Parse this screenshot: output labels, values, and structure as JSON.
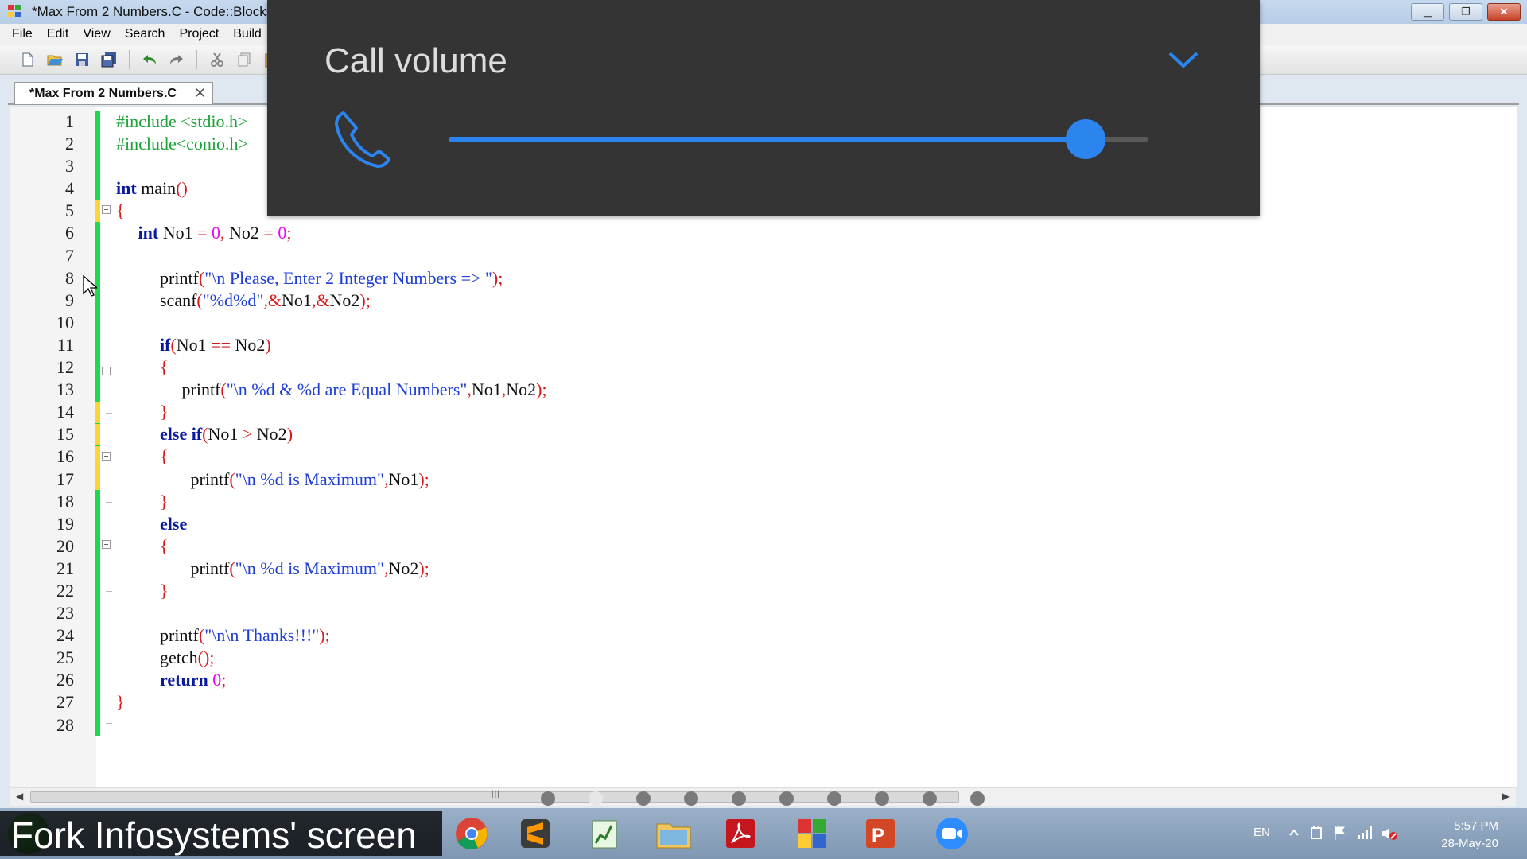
{
  "window": {
    "title": "*Max From 2 Numbers.C - Code::Blocks"
  },
  "menu": [
    "File",
    "Edit",
    "View",
    "Search",
    "Project",
    "Build"
  ],
  "toolbar_icons": [
    "new-file-icon",
    "open-icon",
    "save-icon",
    "save-all-icon",
    "undo-icon",
    "redo-icon",
    "cut-icon",
    "copy-icon",
    "paste-icon"
  ],
  "editor": {
    "tab_label": "*Max From 2 Numbers.C",
    "tab_close": "✕",
    "line_numbers": [
      "1",
      "2",
      "3",
      "4",
      "5",
      "6",
      "7",
      "8",
      "9",
      "10",
      "11",
      "12",
      "13",
      "14",
      "15",
      "16",
      "17",
      "18",
      "19",
      "20",
      "21",
      "22",
      "23",
      "24",
      "25",
      "26",
      "27",
      "28"
    ],
    "lines": [
      [
        {
          "t": "#include <stdio.h>",
          "c": "pp"
        }
      ],
      [
        {
          "t": "#include<conio.h>",
          "c": "pp"
        }
      ],
      [],
      [
        {
          "t": "int",
          "c": "kw"
        },
        {
          "t": " main",
          "c": "id"
        },
        {
          "t": "()",
          "c": "op"
        }
      ],
      [
        {
          "t": "{",
          "c": "op"
        }
      ],
      [
        {
          "t": "     "
        },
        {
          "t": "int",
          "c": "kw"
        },
        {
          "t": " No1 ",
          "c": "id"
        },
        {
          "t": "=",
          "c": "op"
        },
        {
          "t": " "
        },
        {
          "t": "0",
          "c": "num"
        },
        {
          "t": ",",
          "c": "op"
        },
        {
          "t": " No2 ",
          "c": "id"
        },
        {
          "t": "=",
          "c": "op"
        },
        {
          "t": " "
        },
        {
          "t": "0",
          "c": "num"
        },
        {
          "t": ";",
          "c": "op"
        }
      ],
      [],
      [
        {
          "t": "          printf",
          "c": "id"
        },
        {
          "t": "(",
          "c": "op"
        },
        {
          "t": "\"\\n Please, Enter 2 Integer Numbers => \"",
          "c": "str"
        },
        {
          "t": ");",
          "c": "op"
        }
      ],
      [
        {
          "t": "          scanf",
          "c": "id"
        },
        {
          "t": "(",
          "c": "op"
        },
        {
          "t": "\"%d%d\"",
          "c": "str"
        },
        {
          "t": ",&",
          "c": "op"
        },
        {
          "t": "No1",
          "c": "id"
        },
        {
          "t": ",&",
          "c": "op"
        },
        {
          "t": "No2",
          "c": "id"
        },
        {
          "t": ");",
          "c": "op"
        }
      ],
      [],
      [
        {
          "t": "          "
        },
        {
          "t": "if",
          "c": "kw"
        },
        {
          "t": "(",
          "c": "op"
        },
        {
          "t": "No1 ",
          "c": "id"
        },
        {
          "t": "==",
          "c": "op"
        },
        {
          "t": " No2",
          "c": "id"
        },
        {
          "t": ")",
          "c": "op"
        }
      ],
      [
        {
          "t": "          "
        },
        {
          "t": "{",
          "c": "op"
        }
      ],
      [
        {
          "t": "               printf",
          "c": "id"
        },
        {
          "t": "(",
          "c": "op"
        },
        {
          "t": "\"\\n %d & %d are Equal Numbers\"",
          "c": "str"
        },
        {
          "t": ",",
          "c": "op"
        },
        {
          "t": "No1",
          "c": "id"
        },
        {
          "t": ",",
          "c": "op"
        },
        {
          "t": "No2",
          "c": "id"
        },
        {
          "t": ");",
          "c": "op"
        }
      ],
      [
        {
          "t": "          "
        },
        {
          "t": "}",
          "c": "op"
        }
      ],
      [
        {
          "t": "          "
        },
        {
          "t": "else if",
          "c": "kw"
        },
        {
          "t": "(",
          "c": "op"
        },
        {
          "t": "No1 ",
          "c": "id"
        },
        {
          "t": ">",
          "c": "op"
        },
        {
          "t": " No2",
          "c": "id"
        },
        {
          "t": ")",
          "c": "op"
        }
      ],
      [
        {
          "t": "          "
        },
        {
          "t": "{",
          "c": "op"
        }
      ],
      [
        {
          "t": "                 printf",
          "c": "id"
        },
        {
          "t": "(",
          "c": "op"
        },
        {
          "t": "\"\\n %d is Maximum\"",
          "c": "str"
        },
        {
          "t": ",",
          "c": "op"
        },
        {
          "t": "No1",
          "c": "id"
        },
        {
          "t": ");",
          "c": "op"
        }
      ],
      [
        {
          "t": "          "
        },
        {
          "t": "}",
          "c": "op"
        }
      ],
      [
        {
          "t": "          "
        },
        {
          "t": "else",
          "c": "kw"
        }
      ],
      [
        {
          "t": "          "
        },
        {
          "t": "{",
          "c": "op"
        }
      ],
      [
        {
          "t": "                 printf",
          "c": "id"
        },
        {
          "t": "(",
          "c": "op"
        },
        {
          "t": "\"\\n %d is Maximum\"",
          "c": "str"
        },
        {
          "t": ",",
          "c": "op"
        },
        {
          "t": "No2",
          "c": "id"
        },
        {
          "t": ");",
          "c": "op"
        }
      ],
      [
        {
          "t": "          "
        },
        {
          "t": "}",
          "c": "op"
        }
      ],
      [],
      [
        {
          "t": "          printf",
          "c": "id"
        },
        {
          "t": "(",
          "c": "op"
        },
        {
          "t": "\"\\n\\n Thanks!!!\"",
          "c": "str"
        },
        {
          "t": ");",
          "c": "op"
        }
      ],
      [
        {
          "t": "          getch",
          "c": "id"
        },
        {
          "t": "();",
          "c": "op"
        }
      ],
      [
        {
          "t": "          "
        },
        {
          "t": "return",
          "c": "kw"
        },
        {
          "t": " "
        },
        {
          "t": "0",
          "c": "num"
        },
        {
          "t": ";",
          "c": "op"
        }
      ],
      [
        {
          "t": "}",
          "c": "op"
        }
      ],
      []
    ]
  },
  "call_volume": {
    "title": "Call volume",
    "level": 0.91,
    "accent": "#2c84ef"
  },
  "watermark": "Fork Infosystems' screen",
  "taskbar": {
    "apps": [
      "chrome-icon",
      "sublime-text-icon",
      "notepad-icon",
      "file-explorer-icon",
      "acrobat-icon",
      "codeblocks-icon",
      "powerpoint-icon",
      "zoom-icon"
    ],
    "language": "EN",
    "time": "5:57 PM",
    "date": "28-May-20"
  },
  "colors": {
    "preprocessor": "#1aa336",
    "keyword": "#0a1aa0",
    "string": "#1f3fd6",
    "operator": "#d61a1a",
    "number": "#f000f0",
    "change_bar": "#1dd94b",
    "modified_mark": "#ffd43a"
  }
}
